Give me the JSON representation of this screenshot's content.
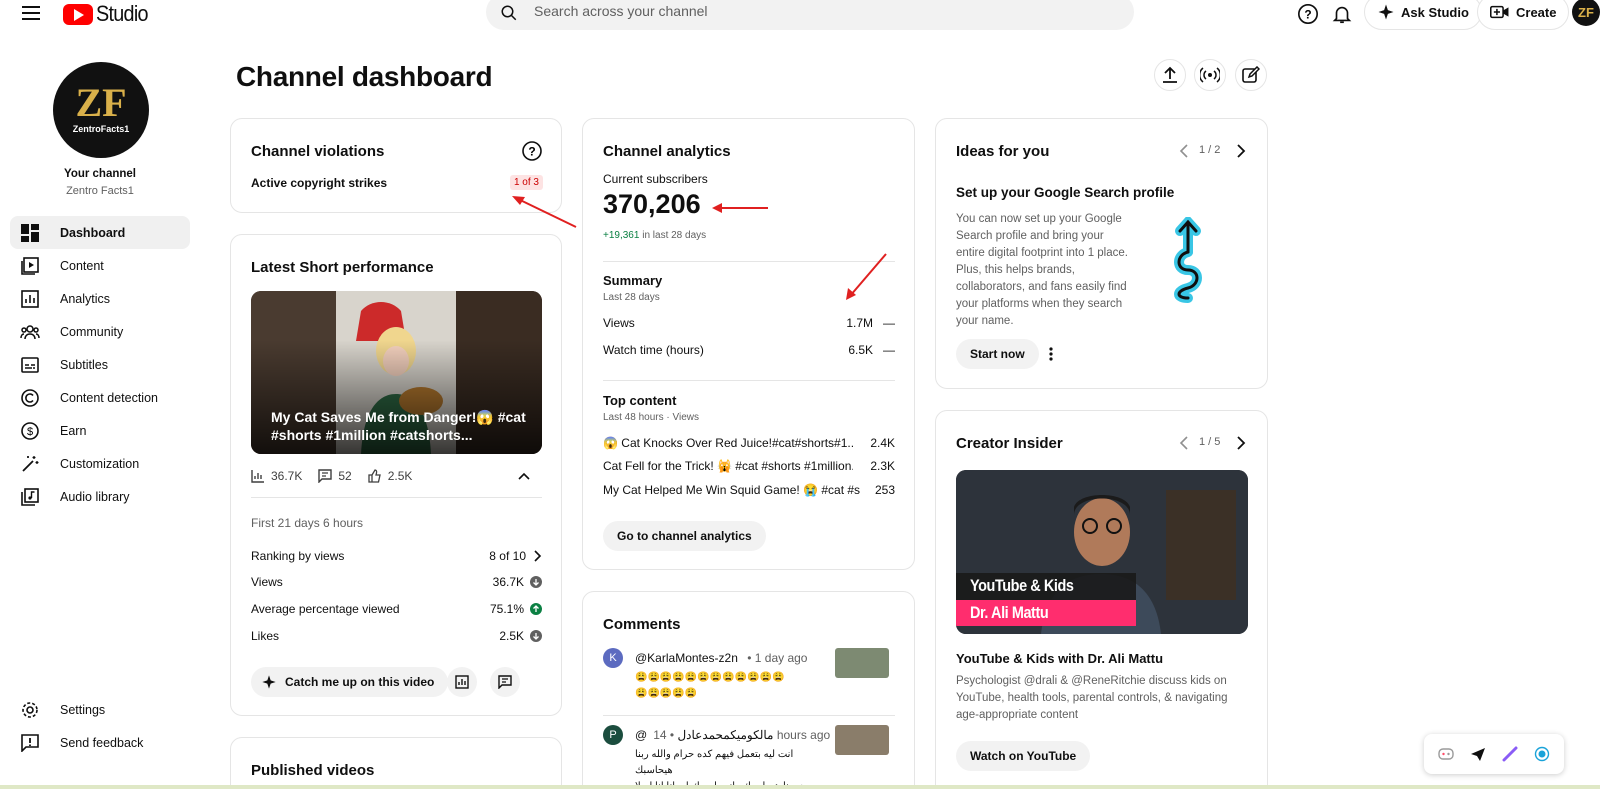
{
  "header": {
    "logo_text": "Studio",
    "search_placeholder": "Search across your channel",
    "ask_studio": "Ask Studio",
    "create": "Create"
  },
  "sidebar": {
    "channel_label": "Your channel",
    "channel_name": "Zentro Facts1",
    "avatar_text": "ZentroFacts1",
    "items": [
      {
        "label": "Dashboard",
        "icon": "dashboard-icon"
      },
      {
        "label": "Content",
        "icon": "content-icon"
      },
      {
        "label": "Analytics",
        "icon": "analytics-icon"
      },
      {
        "label": "Community",
        "icon": "community-icon"
      },
      {
        "label": "Subtitles",
        "icon": "subtitles-icon"
      },
      {
        "label": "Content detection",
        "icon": "copyright-icon"
      },
      {
        "label": "Earn",
        "icon": "dollar-icon"
      },
      {
        "label": "Customization",
        "icon": "wand-icon"
      },
      {
        "label": "Audio library",
        "icon": "audio-library-icon"
      }
    ],
    "bottom": [
      {
        "label": "Settings",
        "icon": "gear-icon"
      },
      {
        "label": "Send feedback",
        "icon": "feedback-icon"
      }
    ]
  },
  "page": {
    "title": "Channel dashboard"
  },
  "violations": {
    "title": "Channel violations",
    "label": "Active copyright strikes",
    "badge": "1 of 3"
  },
  "short_perf": {
    "title": "Latest Short performance",
    "video_title": "My Cat Saves Me from Danger!😱 #cat #shorts #1million #catshorts...",
    "views": "36.7K",
    "comments": "52",
    "likes": "2.5K",
    "period": "First 21 days 6 hours",
    "rows": [
      {
        "label": "Ranking by views",
        "value": "8 of 10"
      },
      {
        "label": "Views",
        "value": "36.7K"
      },
      {
        "label": "Average percentage viewed",
        "value": "75.1%"
      },
      {
        "label": "Likes",
        "value": "2.5K"
      }
    ],
    "catch_up": "Catch me up on this video"
  },
  "published": {
    "title": "Published videos"
  },
  "analytics": {
    "title": "Channel analytics",
    "subs_label": "Current subscribers",
    "subs_value": "370,206",
    "subs_change": "+19,361",
    "subs_change_suffix": "in last 28 days",
    "summary_title": "Summary",
    "summary_period": "Last 28 days",
    "summary_rows": [
      {
        "label": "Views",
        "value": "1.7M",
        "trend": "—"
      },
      {
        "label": "Watch time (hours)",
        "value": "6.5K",
        "trend": "—"
      }
    ],
    "top_title": "Top content",
    "top_period": "Last 48 hours · Views",
    "top_rows": [
      {
        "label": "😱 Cat Knocks Over Red Juice!#cat#shorts#1...",
        "value": "2.4K"
      },
      {
        "label": "Cat Fell for the Trick! 🙀 #cat #shorts #1million...",
        "value": "2.3K"
      },
      {
        "label": "My Cat Helped Me Win Squid Game! 😭 #cat #s...",
        "value": "253"
      }
    ],
    "cta": "Go to channel analytics"
  },
  "comments": {
    "title": "Comments",
    "items": [
      {
        "initial": "K",
        "author": "@KarlaMontes-z2n",
        "time": "• 1 day ago",
        "text": "😩😩😩😩😩😩😩😩😩😩😩😩\n😩😩😩😩😩"
      },
      {
        "initial": "P",
        "author": "@مالكوميكمحمدعادل",
        "time": "• 14 hours ago",
        "text": "انت ليه بتعمل فيهم كده حرام والله ربنا هيحاسبك\nمد ربنا هيحاسبك وانت اسمك ايه انا انا اصلا مش..."
      }
    ]
  },
  "ideas": {
    "title": "Ideas for you",
    "pager": "1 / 2",
    "heading": "Set up your Google Search profile",
    "body": "You can now set up your Google Search profile and bring your entire digital footprint into 1 place. Plus, this helps brands, collaborators, and fans easily find your platforms when they search your name.",
    "cta": "Start now"
  },
  "insider": {
    "title": "Creator Insider",
    "pager": "1 / 5",
    "thumb_line1": "YouTube & Kids",
    "thumb_line2": "Dr. Ali Mattu",
    "video_title": "YouTube & Kids with Dr. Ali Mattu",
    "desc": "Psychologist @drali & @ReneRitchie discuss kids on YouTube, health tools, parental controls, & navigating age-appropriate content",
    "cta": "Watch on YouTube"
  },
  "colors": {
    "accent_red": "#ff0000",
    "positive_green": "#0b8043",
    "pink_banner": "#ff2d6e"
  }
}
